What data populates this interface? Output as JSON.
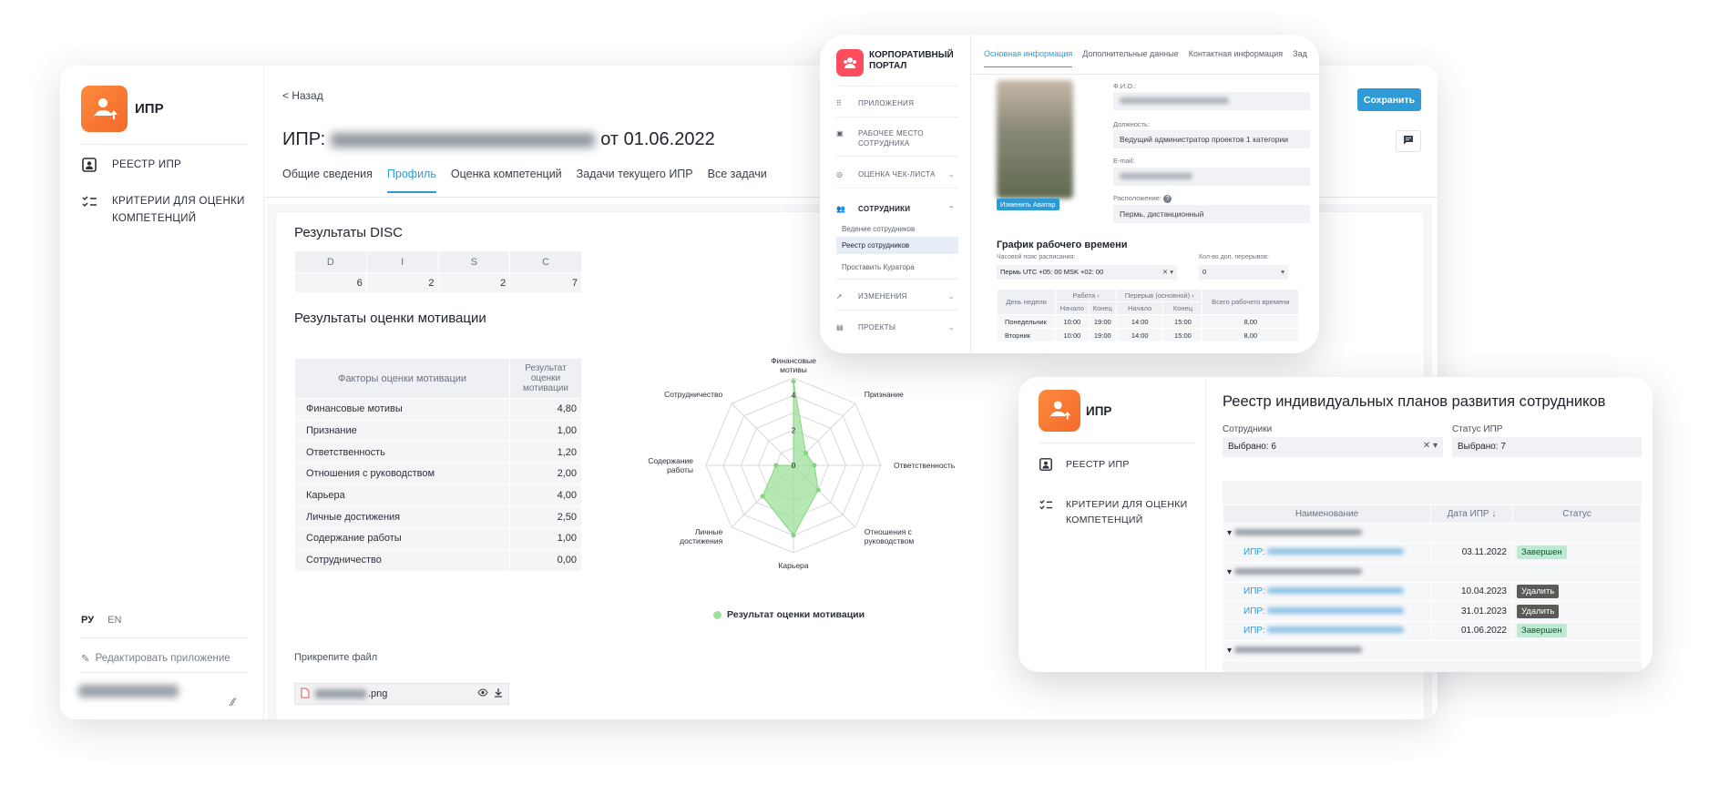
{
  "main": {
    "app_name": "ИПР",
    "sidebar": {
      "items": [
        {
          "label": "РЕЕСТР ИПР",
          "icon": "badge-icon"
        },
        {
          "label": "КРИТЕРИИ ДЛЯ ОЦЕНКИ КОМПЕТЕНЦИЙ",
          "icon": "checklist-icon"
        }
      ],
      "lang_ru": "РУ",
      "lang_en": "EN",
      "edit_app": "Редактировать приложение"
    },
    "back": "< Назад",
    "title_prefix": "ИПР:",
    "title_suffix": "от 01.06.2022",
    "tabs": [
      "Общие сведения",
      "Профиль",
      "Оценка компетенций",
      "Задачи текущего ИПР",
      "Все задачи"
    ],
    "active_tab": "Профиль",
    "disc": {
      "title": "Результаты DISC",
      "headers": [
        "D",
        "I",
        "S",
        "C"
      ],
      "values": [
        "6",
        "2",
        "2",
        "7"
      ]
    },
    "motivation": {
      "title": "Результаты оценки мотивации",
      "col_factor": "Факторы оценки мотивации",
      "col_result": "Результат оценки мотивации",
      "rows": [
        {
          "factor": "Финансовые мотивы",
          "value": "4,80"
        },
        {
          "factor": "Признание",
          "value": "1,00"
        },
        {
          "factor": "Ответственность",
          "value": "1,20"
        },
        {
          "factor": "Отношения с руководством",
          "value": "2,00"
        },
        {
          "factor": "Карьера",
          "value": "4,00"
        },
        {
          "factor": "Личные достижения",
          "value": "2,50"
        },
        {
          "factor": "Содержание работы",
          "value": "1,00"
        },
        {
          "factor": "Сотрудничество",
          "value": "0,00"
        }
      ]
    },
    "attach_label": "Прикрепите файл",
    "file_ext": ".png"
  },
  "chart_data": {
    "type": "radar",
    "axes": [
      "Финансовые мотивы",
      "Признание",
      "Ответственность",
      "Отношения с руководством",
      "Карьера",
      "Личные достижения",
      "Содержание работы",
      "Сотрудничество"
    ],
    "series": [
      {
        "name": "Результат оценки мотивации",
        "values": [
          4.8,
          1.0,
          1.2,
          2.0,
          4.0,
          2.5,
          1.0,
          0.0
        ]
      }
    ],
    "ticks": [
      "0",
      "2",
      "4"
    ],
    "range": [
      0,
      5
    ],
    "legend": "bottom",
    "color": "#9ee09a"
  },
  "portal": {
    "name": "КОРПОРАТИВНЫЙ ПОРТАЛ",
    "nav": {
      "apps": "ПРИЛОЖЕНИЯ",
      "workplace": "РАБОЧЕЕ МЕСТО СОТРУДНИКА",
      "checklist": "ОЦЕНКА ЧЕК-ЛИСТА",
      "employees": "СОТРУДНИКИ",
      "sub_keep": "Ведение сотрудников",
      "sub_registry": "Реестр сотрудников",
      "sub_curator": "Проставить Куратора",
      "changes": "ИЗМЕНЕНИЯ",
      "projects": "ПРОЕКТЫ"
    },
    "tabs": [
      "Основная информация",
      "Дополнительные данные",
      "Контактная информация",
      "Зад"
    ],
    "change_avatar": "Изменить Аватар",
    "fio_label": "Ф.И.О.:",
    "position_label": "Должность:",
    "position_value": "Ведущий администратор проектов 1 категории",
    "email_label": "E-mail:",
    "location_label": "Расположение:",
    "location_value": "Пермь, дистанционный",
    "schedule_title": "График рабочего времени",
    "tz_label": "Часовой пояс расписания:",
    "tz_value": "Пермь UTC +05: 00 MSK +02: 00",
    "breaks_label": "Кол-во доп. перерывов:",
    "breaks_value": "0",
    "table": {
      "col_day": "День недели",
      "col_work": "Работа",
      "col_break": "Перерыв (основной)",
      "col_total": "Всего рабочего времени",
      "start": "Начало",
      "end": "Конец",
      "rows": [
        {
          "day": "Понедельник",
          "ws": "10:00",
          "we": "19:00",
          "bs": "14:00",
          "be": "15:00",
          "total": "8,00"
        },
        {
          "day": "Вторник",
          "ws": "10:00",
          "we": "19:00",
          "bs": "14:00",
          "be": "15:00",
          "total": "8,00"
        }
      ]
    },
    "save": "Сохранить"
  },
  "registry": {
    "app_name": "ИПР",
    "items": [
      "РЕЕСТР ИПР",
      "КРИТЕРИИ ДЛЯ ОЦЕНКИ КОМПЕТЕНЦИЙ"
    ],
    "title": "Реестр индивидуальных планов развития сотрудников",
    "employees_label": "Сотрудники",
    "employees_value": "Выбрано: 6",
    "status_label": "Статус ИПР",
    "status_value": "Выбрано: 7",
    "col_name": "Наименование",
    "col_date": "Дата ИПР",
    "col_status": "Статус",
    "link_prefix": "ИПР:",
    "rows": [
      {
        "date": "03.11.2022",
        "status": "Завершен"
      },
      {
        "date": "10.04.2023",
        "status": "Удалить"
      },
      {
        "date": "31.01.2023",
        "status": "Удалить"
      },
      {
        "date": "01.06.2022",
        "status": "Завершен"
      }
    ]
  }
}
